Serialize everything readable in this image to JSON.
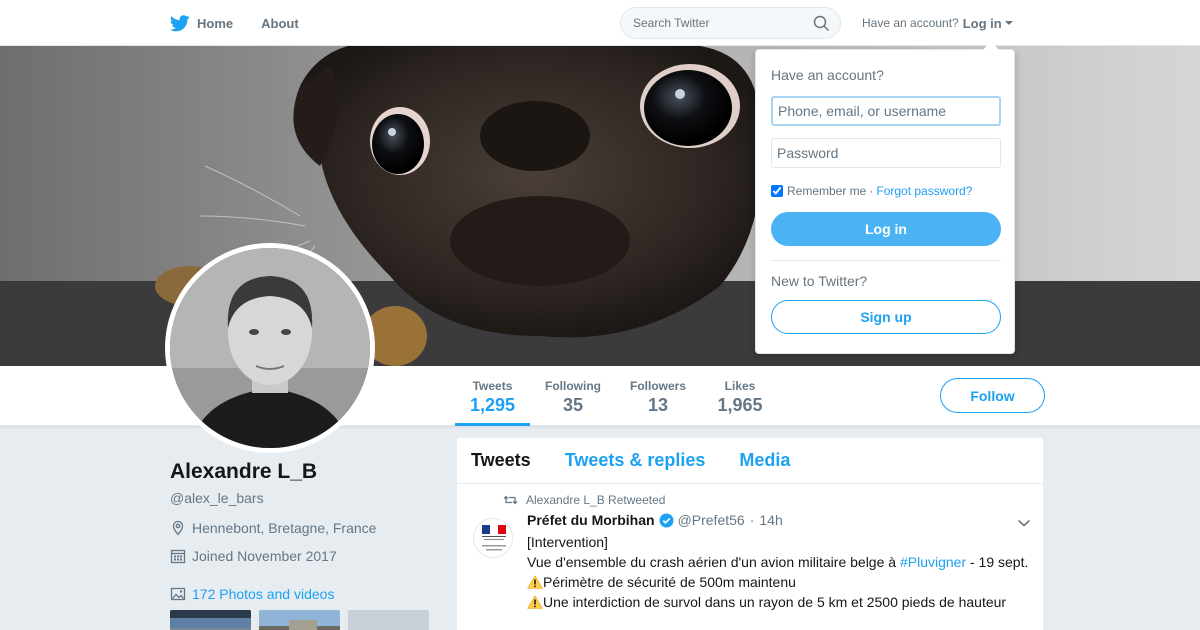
{
  "nav": {
    "home_label": "Home",
    "about_label": "About",
    "search_placeholder": "Search Twitter",
    "have_account": "Have an account?",
    "login_label": "Log in"
  },
  "profile": {
    "name": "Alexandre L_B",
    "handle": "@alex_le_bars",
    "location": "Hennebont, Bretagne, France",
    "joined": "Joined November 2017",
    "photos_label": "172 Photos and videos",
    "follow_label": "Follow"
  },
  "stats": [
    {
      "label": "Tweets",
      "value": "1,295"
    },
    {
      "label": "Following",
      "value": "35"
    },
    {
      "label": "Followers",
      "value": "13"
    },
    {
      "label": "Likes",
      "value": "1,965"
    }
  ],
  "timeline": {
    "tabs": [
      "Tweets",
      "Tweets & replies",
      "Media"
    ],
    "tweet": {
      "retweet_note": "Alexandre L_B Retweeted",
      "author": "Préfet du Morbihan",
      "handle": "@Prefet56",
      "time": "14h",
      "line1": "[Intervention]",
      "line2_pre": "Vue d'ensemble du crash aérien d'un avion militaire belge à ",
      "hashtag": "#Pluvigner",
      "line2_post": " - 19 sept.",
      "line3": "Périmètre de sécurité de 500m maintenu",
      "line4": "Une interdiction de survol dans un rayon de 5 km et 2500 pieds de hauteur",
      "avatar_caption": "PRÉFET DU MORBIHAN"
    }
  },
  "login_dropdown": {
    "title": "Have an account?",
    "username_placeholder": "Phone, email, or username",
    "password_placeholder": "Password",
    "remember_label": "Remember me",
    "separator": "·",
    "forgot_label": "Forgot password?",
    "login_button": "Log in",
    "new_label": "New to Twitter?",
    "signup_button": "Sign up"
  },
  "colors": {
    "accent": "#1da1f2",
    "login_button": "#4ab3f4",
    "background": "#e6ecf0"
  }
}
